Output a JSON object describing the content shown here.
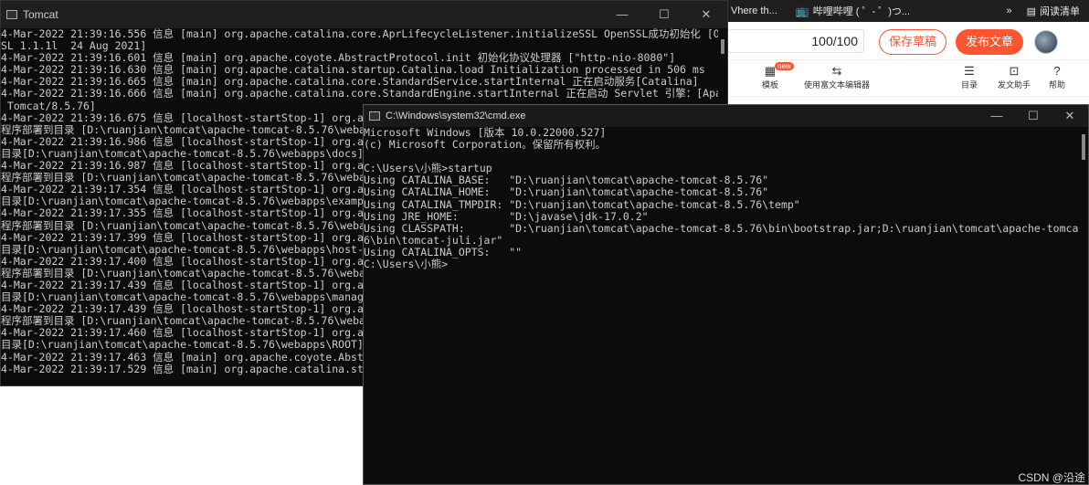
{
  "browser": {
    "tabs": [
      {
        "label": "Vhere th...",
        "icon": "none"
      },
      {
        "label": "哔哩哔哩 ( ゜- ゜)つ...",
        "icon": "bilibili-icon"
      },
      {
        "label": "»"
      },
      {
        "label": "阅读清单",
        "icon": "reading-list-icon"
      }
    ]
  },
  "editor": {
    "progress": "100/100",
    "save_draft": "保存草稿",
    "publish": "发布文章",
    "toolbar": [
      {
        "label": "模板",
        "icon": "template-icon",
        "badge": "new"
      },
      {
        "label": "使用富文本编辑器",
        "icon": "switch-icon"
      },
      {
        "label": "目录",
        "icon": "toc-icon"
      },
      {
        "label": "发文助手",
        "icon": "assistant-icon"
      },
      {
        "label": "帮助",
        "icon": "help-icon"
      }
    ]
  },
  "tomcat_window": {
    "title": "Tomcat",
    "lines": [
      "4-Mar-2022 21:39:16.556 信息 [main] org.apache.catalina.core.AprLifecycleListener.initializeSSL OpenSSL成功初始化 [Open",
      "SL 1.1.1l  24 Aug 2021]",
      "4-Mar-2022 21:39:16.601 信息 [main] org.apache.coyote.AbstractProtocol.init 初始化协议处理器 [\"http-nio-8080\"]",
      "4-Mar-2022 21:39:16.630 信息 [main] org.apache.catalina.startup.Catalina.load Initialization processed in 506 ms",
      "4-Mar-2022 21:39:16.665 信息 [main] org.apache.catalina.core.StandardService.startInternal 正在启动服务[Catalina]",
      "4-Mar-2022 21:39:16.666 信息 [main] org.apache.catalina.core.StandardEngine.startInternal 正在启动 Servlet 引擎：[Apach",
      " Tomcat/8.5.76]",
      "4-Mar-2022 21:39:16.675 信息 [localhost-startStop-1] org.apac",
      "程序部署到目录 [D:\\ruanjian\\tomcat\\apache-tomcat-8.5.76\\webapp",
      "4-Mar-2022 21:39:16.986 信息 [localhost-startStop-1] org.apac",
      "目录[D:\\ruanjian\\tomcat\\apache-tomcat-8.5.76\\webapps\\docs]的部",
      "4-Mar-2022 21:39:16.987 信息 [localhost-startStop-1] org.apac",
      "程序部署到目录 [D:\\ruanjian\\tomcat\\apache-tomcat-8.5.76\\webapp",
      "4-Mar-2022 21:39:17.354 信息 [localhost-startStop-1] org.apac",
      "目录[D:\\ruanjian\\tomcat\\apache-tomcat-8.5.76\\webapps\\examples",
      "4-Mar-2022 21:39:17.355 信息 [localhost-startStop-1] org.apac",
      "程序部署到目录 [D:\\ruanjian\\tomcat\\apache-tomcat-8.5.76\\webapp",
      "4-Mar-2022 21:39:17.399 信息 [localhost-startStop-1] org.apac",
      "目录[D:\\ruanjian\\tomcat\\apache-tomcat-8.5.76\\webapps\\host-man",
      "4-Mar-2022 21:39:17.400 信息 [localhost-startStop-1] org.apac",
      "程序部署到目录 [D:\\ruanjian\\tomcat\\apache-tomcat-8.5.76\\webapp",
      "4-Mar-2022 21:39:17.439 信息 [localhost-startStop-1] org.apac",
      "目录[D:\\ruanjian\\tomcat\\apache-tomcat-8.5.76\\webapps\\manager]",
      "4-Mar-2022 21:39:17.439 信息 [localhost-startStop-1] org.apac",
      "程序部署到目录 [D:\\ruanjian\\tomcat\\apache-tomcat-8.5.76\\webapp",
      "4-Mar-2022 21:39:17.460 信息 [localhost-startStop-1] org.apac",
      "目录[D:\\ruanjian\\tomcat\\apache-tomcat-8.5.76\\webapps\\ROOT]的部",
      "4-Mar-2022 21:39:17.463 信息 [main] org.apache.coyote.Abstrac",
      "4-Mar-2022 21:39:17.529 信息 [main] org.apache.catalina.star"
    ]
  },
  "cmd_window": {
    "title": "C:\\Windows\\system32\\cmd.exe",
    "lines": [
      "Microsoft Windows [版本 10.0.22000.527]",
      "(c) Microsoft Corporation。保留所有权利。",
      "",
      "C:\\Users\\小熊>startup",
      "Using CATALINA_BASE:   \"D:\\ruanjian\\tomcat\\apache-tomcat-8.5.76\"",
      "Using CATALINA_HOME:   \"D:\\ruanjian\\tomcat\\apache-tomcat-8.5.76\"",
      "Using CATALINA_TMPDIR: \"D:\\ruanjian\\tomcat\\apache-tomcat-8.5.76\\temp\"",
      "Using JRE_HOME:        \"D:\\javase\\jdk-17.0.2\"",
      "Using CLASSPATH:       \"D:\\ruanjian\\tomcat\\apache-tomcat-8.5.76\\bin\\bootstrap.jar;D:\\ruanjian\\tomcat\\apache-tomcat-8.5.7",
      "6\\bin\\tomcat-juli.jar\"",
      "Using CATALINA_OPTS:   \"\"",
      "C:\\Users\\小熊>"
    ]
  },
  "watermark": "CSDN @沿途"
}
